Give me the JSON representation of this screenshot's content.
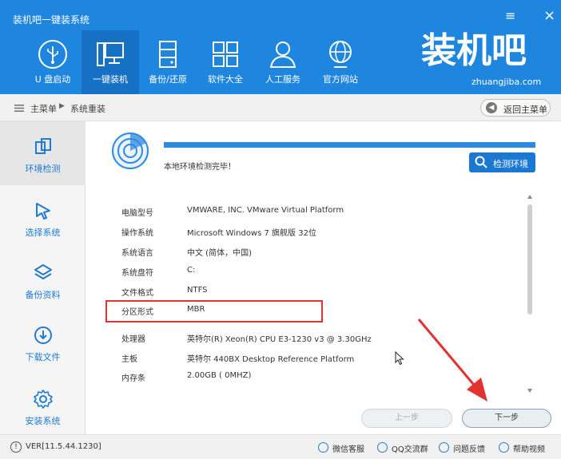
{
  "window": {
    "title": "装机吧一键装系统",
    "menu_icon": "≡",
    "close_icon": "×"
  },
  "nav": {
    "items": [
      {
        "label": "U 盘启动",
        "icon": "usb-icon"
      },
      {
        "label": "一键装机",
        "icon": "monitor-icon",
        "active": true
      },
      {
        "label": "备份/还原",
        "icon": "server-icon"
      },
      {
        "label": "软件大全",
        "icon": "grid-icon"
      },
      {
        "label": "人工服务",
        "icon": "user-icon"
      },
      {
        "label": "官方网站",
        "icon": "globe-icon"
      }
    ]
  },
  "brand": {
    "logo": "装机吧",
    "url": "zhuangjiba.com"
  },
  "breadcrumb": {
    "home": "主菜单",
    "separator": "▶",
    "current": "系统重装",
    "back_label": "返回主菜单"
  },
  "sidebar": {
    "items": [
      {
        "label": "环境检测",
        "icon": "copy-icon",
        "active": true
      },
      {
        "label": "选择系统",
        "icon": "cursor-icon"
      },
      {
        "label": "备份资料",
        "icon": "layers-icon"
      },
      {
        "label": "下载文件",
        "icon": "download-icon"
      },
      {
        "label": "安装系统",
        "icon": "gear-icon"
      }
    ]
  },
  "detection": {
    "progress": 1.0,
    "status": "本地环境检测完毕！",
    "check_button": "检测环境"
  },
  "info": [
    {
      "key": "电脑型号",
      "value": "VMWARE, INC. VMware Virtual Platform"
    },
    {
      "key": "操作系统",
      "value": "Microsoft Windows 7 旗舰版  32位"
    },
    {
      "key": "系统语言",
      "value": "中文 (简体，中国)"
    },
    {
      "key": "系统盘符",
      "value": "C:"
    },
    {
      "key": "文件格式",
      "value": "NTFS"
    },
    {
      "key": "分区形式",
      "value": "MBR"
    },
    {
      "key": "处理器",
      "value": "英特尔(R) Xeon(R) CPU E3-1230 v3 @ 3.30GHz"
    },
    {
      "key": "主板",
      "value": "英特尔 440BX Desktop Reference Platform"
    },
    {
      "key": "内存条",
      "value": "2.00GB ( 0MHZ)"
    }
  ],
  "buttons": {
    "prev": "上一步",
    "next": "下一步"
  },
  "footer": {
    "version": "VER[11.5.44.1230]",
    "links": [
      {
        "label": "微信客服",
        "icon": "wechat-icon"
      },
      {
        "label": "QQ交流群",
        "icon": "qq-icon"
      },
      {
        "label": "问题反馈",
        "icon": "feedback-icon"
      },
      {
        "label": "帮助视频",
        "icon": "help-icon"
      }
    ]
  },
  "colors": {
    "header": "#1f86e0",
    "active_nav": "#1670c4",
    "accent": "#1a78d2",
    "highlight_box": "#e23232"
  }
}
